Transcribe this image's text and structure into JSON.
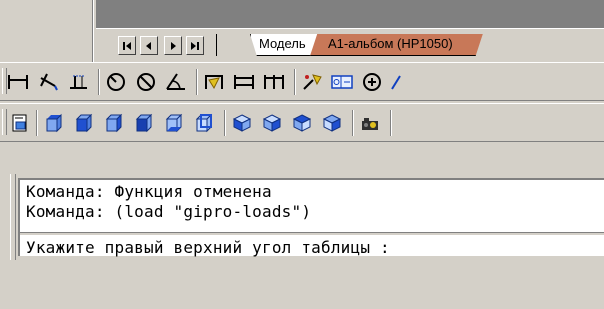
{
  "tabs": {
    "model": "Модель",
    "layout": "А1-альбом (HP1050)"
  },
  "command_line": {
    "lines": [
      "Команда: Функция отменена",
      "Команда: (load \"gipro-loads\")"
    ],
    "prompt": "Укажите правый верхний угол таблицы :"
  },
  "toolbar_dimension": {
    "icons": [
      "linear-dimension-icon",
      "aligned-dimension-icon",
      "ordinate-dimension-icon",
      "radius-dimension-icon",
      "diameter-dimension-icon",
      "angular-dimension-icon",
      "quick-dimension-icon",
      "baseline-dimension-icon",
      "continue-dimension-icon",
      "leader-icon",
      "tolerance-icon",
      "center-mark-icon"
    ]
  },
  "toolbar_3d": {
    "icons": [
      "3d-view-icon",
      "top-view-icon",
      "bottom-view-icon",
      "left-view-icon",
      "right-view-icon",
      "front-view-icon",
      "back-view-icon",
      "sw-isometric-icon",
      "se-isometric-icon",
      "ne-isometric-icon",
      "nw-isometric-icon",
      "camera-icon"
    ]
  },
  "colors": {
    "active_tab": "#c87858",
    "window_bg": "#d4d0c8",
    "canvas_gray": "#808080"
  }
}
